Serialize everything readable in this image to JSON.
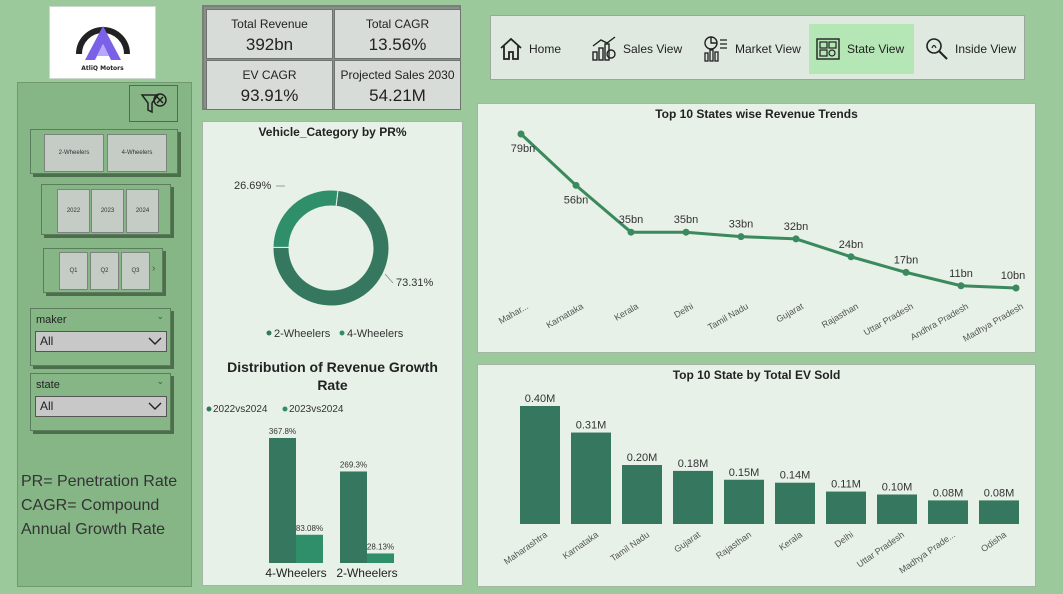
{
  "logo": {
    "text": "AtliQ Motors"
  },
  "kpis": [
    {
      "label": "Total Revenue",
      "value": "392bn"
    },
    {
      "label": "Total CAGR",
      "value": "13.56%"
    },
    {
      "label": "EV CAGR",
      "value": "93.91%"
    },
    {
      "label": "Projected Sales 2030",
      "value": "54.21M"
    }
  ],
  "nav": [
    {
      "label": "Home",
      "icon": "home-icon"
    },
    {
      "label": "Sales View",
      "icon": "sales-chart-icon"
    },
    {
      "label": "Market View",
      "icon": "market-chart-icon"
    },
    {
      "label": "State View",
      "icon": "map-icon",
      "active": true
    },
    {
      "label": "Inside View",
      "icon": "bulb-search-icon"
    }
  ],
  "slicers": {
    "category": [
      "2-Wheelers",
      "4-Wheelers"
    ],
    "years": [
      "2022",
      "2023",
      "2024"
    ],
    "quarters": [
      "Q1",
      "Q2",
      "Q3"
    ],
    "maker": {
      "label": "maker",
      "value": "All"
    },
    "state": {
      "label": "state",
      "value": "All"
    }
  },
  "notes": [
    "PR= Penetration Rate",
    "CAGR= Compound",
    "Annual Growth Rate"
  ],
  "colors": {
    "dark": "#35785f",
    "light": "#2f8f6b",
    "accent": "#3a8a5e"
  },
  "chart_data": [
    {
      "type": "pie",
      "title": "Vehicle_Category by PR%",
      "categories": [
        "2-Wheelers",
        "4-Wheelers"
      ],
      "values": [
        73.31,
        26.69
      ],
      "labels": [
        "73.31%",
        "26.69%"
      ],
      "legend": "bottom"
    },
    {
      "type": "bar",
      "title": "Distribution of Revenue Growth Rate",
      "categories": [
        "4-Wheelers",
        "2-Wheelers"
      ],
      "series": [
        {
          "name": "2022vs2024",
          "values": [
            367.8,
            269.3
          ],
          "labels": [
            "367.8%",
            "269.3%"
          ]
        },
        {
          "name": "2023vs2024",
          "values": [
            83.08,
            28.13
          ],
          "labels": [
            "83.08%",
            "28.13%"
          ]
        }
      ],
      "legend": "top-left"
    },
    {
      "type": "line",
      "title": "Top 10 States wise Revenue Trends",
      "categories": [
        "Mahar...",
        "Karnataka",
        "Kerala",
        "Delhi",
        "Tamil Nadu",
        "Gujarat",
        "Rajasthan",
        "Uttar Pradesh",
        "Andhra Pradesh",
        "Madhya Pradesh"
      ],
      "values": [
        79,
        56,
        35,
        35,
        33,
        32,
        24,
        17,
        11,
        10
      ],
      "labels": [
        "79bn",
        "56bn",
        "35bn",
        "35bn",
        "33bn",
        "32bn",
        "24bn",
        "17bn",
        "11bn",
        "10bn"
      ]
    },
    {
      "type": "bar",
      "title": "Top 10 State by Total EV Sold",
      "categories": [
        "Maharashtra",
        "Karnataka",
        "Tamil Nadu",
        "Gujarat",
        "Rajasthan",
        "Kerala",
        "Delhi",
        "Uttar Pradesh",
        "Madhya Prade...",
        "Odisha"
      ],
      "values": [
        0.4,
        0.31,
        0.2,
        0.18,
        0.15,
        0.14,
        0.11,
        0.1,
        0.08,
        0.08
      ],
      "labels": [
        "0.40M",
        "0.31M",
        "0.20M",
        "0.18M",
        "0.15M",
        "0.14M",
        "0.11M",
        "0.10M",
        "0.08M",
        "0.08M"
      ]
    }
  ]
}
